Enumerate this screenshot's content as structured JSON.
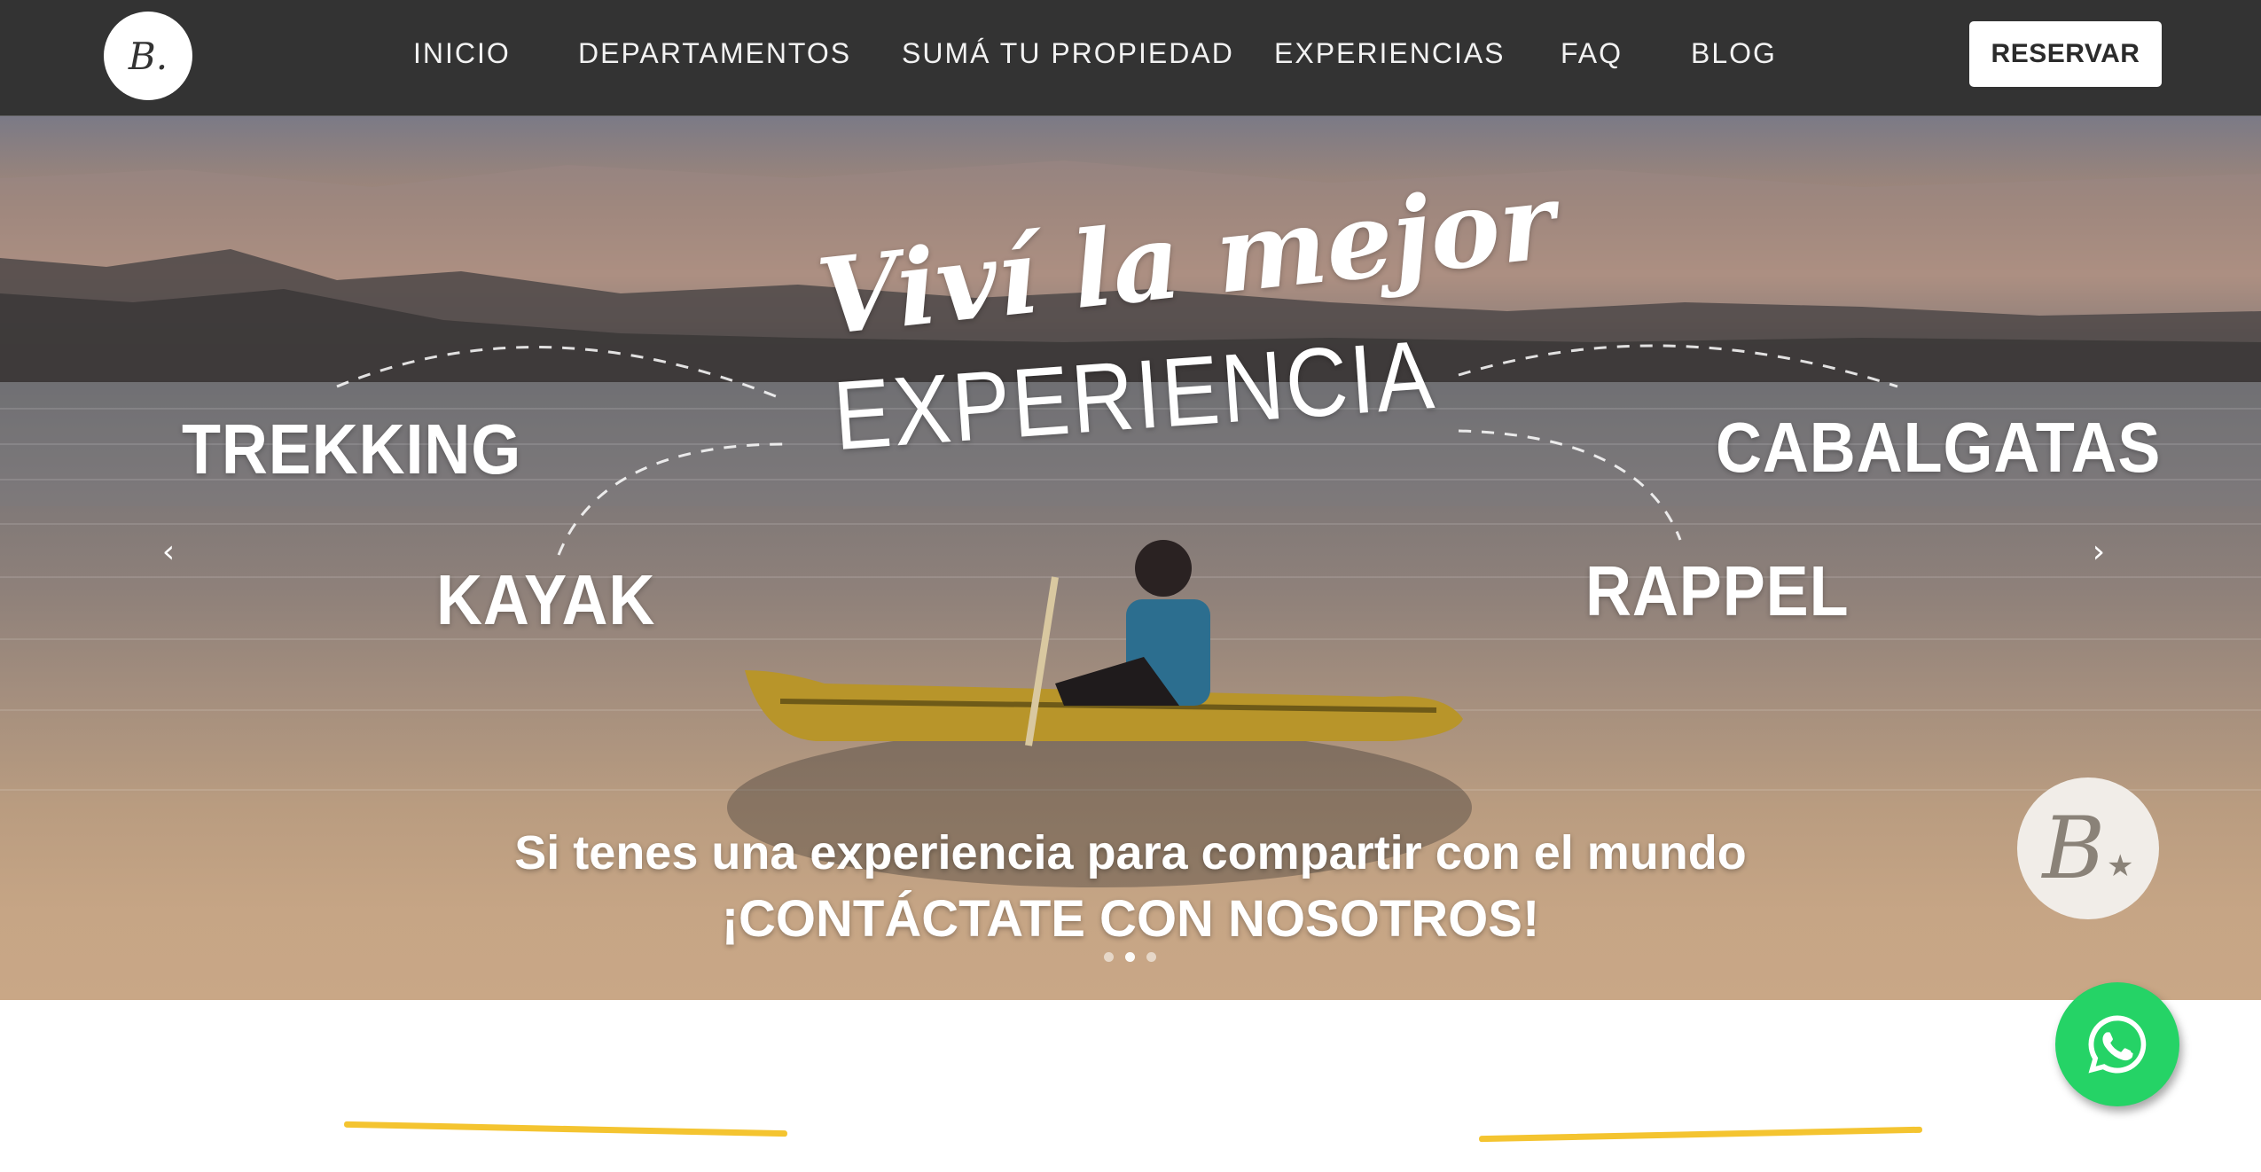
{
  "header": {
    "logo_letter": "B.",
    "nav": [
      "INICIO",
      "DEPARTAMENTOS",
      "SUMÁ TU PROPIEDAD",
      "EXPERIENCIAS",
      "FAQ",
      "BLOG"
    ],
    "reserve_label": "RESERVAR"
  },
  "hero": {
    "headline_script": "Viví la mejor",
    "headline_caps": "EXPERIENCIA",
    "activities": {
      "trekking": "TREKKING",
      "kayak": "KAYAK",
      "cabalgatas": "CABALGATAS",
      "rappel": "RAPPEL"
    },
    "caption_line1": "Si tenes una experiencia para compartir con el mundo",
    "caption_line2": "¡CONTÁCTATE CON NOSOTROS!",
    "slides_total": 3,
    "active_slide": 2,
    "badge_letter": "B"
  },
  "colors": {
    "header_bg": "#333333",
    "accent_yellow": "#f4c430",
    "whatsapp_green": "#25d366"
  },
  "icons": [
    "logo-icon",
    "chevron-left-icon",
    "chevron-right-icon",
    "whatsapp-icon",
    "brand-badge-icon"
  ]
}
